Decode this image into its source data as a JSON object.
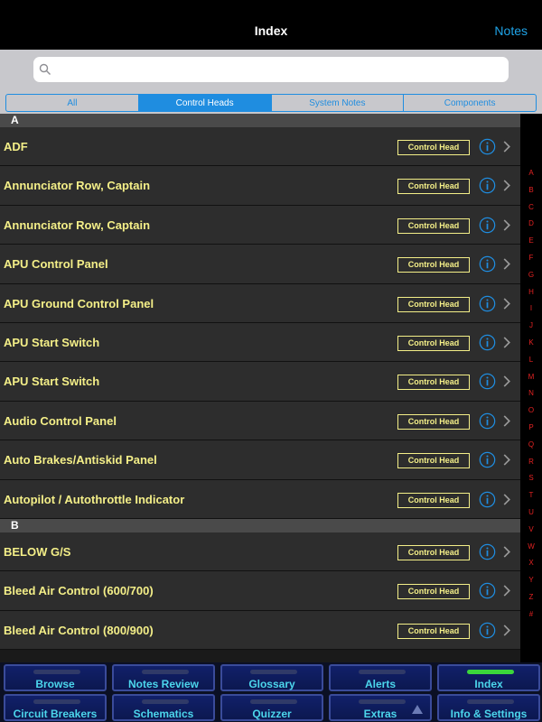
{
  "navbar": {
    "title": "Index",
    "right_button": "Notes"
  },
  "search": {
    "placeholder": ""
  },
  "segments": [
    {
      "label": "All",
      "active": false
    },
    {
      "label": "Control Heads",
      "active": true
    },
    {
      "label": "System Notes",
      "active": false
    },
    {
      "label": "Components",
      "active": false
    }
  ],
  "sections": [
    {
      "header": "A",
      "rows": [
        {
          "label": "ADF",
          "badge": "Control Head"
        },
        {
          "label": "Annunciator Row, Captain",
          "badge": "Control Head"
        },
        {
          "label": "Annunciator Row, Captain",
          "badge": "Control Head"
        },
        {
          "label": "APU Control Panel",
          "badge": "Control Head"
        },
        {
          "label": "APU Ground Control Panel",
          "badge": "Control Head"
        },
        {
          "label": "APU Start Switch",
          "badge": "Control Head"
        },
        {
          "label": "APU Start Switch",
          "badge": "Control Head"
        },
        {
          "label": "Audio Control Panel",
          "badge": "Control Head"
        },
        {
          "label": "Auto Brakes/Antiskid Panel",
          "badge": "Control Head"
        },
        {
          "label": "Autopilot / Autothrottle Indicator",
          "badge": "Control Head"
        }
      ]
    },
    {
      "header": "B",
      "rows": [
        {
          "label": "BELOW G/S",
          "badge": "Control Head"
        },
        {
          "label": "Bleed Air Control (600/700)",
          "badge": "Control Head"
        },
        {
          "label": "Bleed Air Control (800/900)",
          "badge": "Control Head"
        }
      ]
    }
  ],
  "index_letters": [
    "A",
    "B",
    "C",
    "D",
    "E",
    "F",
    "G",
    "H",
    "I",
    "J",
    "K",
    "L",
    "M",
    "N",
    "O",
    "P",
    "Q",
    "R",
    "S",
    "T",
    "U",
    "V",
    "W",
    "X",
    "Y",
    "Z",
    "#"
  ],
  "tabs": [
    {
      "label": "Browse",
      "active": false
    },
    {
      "label": "Notes Review",
      "active": false
    },
    {
      "label": "Glossary",
      "active": false
    },
    {
      "label": "Alerts",
      "active": false
    },
    {
      "label": "Index",
      "active": true
    },
    {
      "label": "Circuit Breakers",
      "active": false
    },
    {
      "label": "Schematics",
      "active": false
    },
    {
      "label": "Quizzer",
      "active": false
    },
    {
      "label": "Extras",
      "active": false,
      "has_arrow": true
    },
    {
      "label": "Info & Settings",
      "active": false
    }
  ],
  "colors": {
    "accent": "#1f8de0",
    "row_text": "#f4ef88",
    "index_letter": "#e32222",
    "tab_label": "#4cd6ec"
  }
}
